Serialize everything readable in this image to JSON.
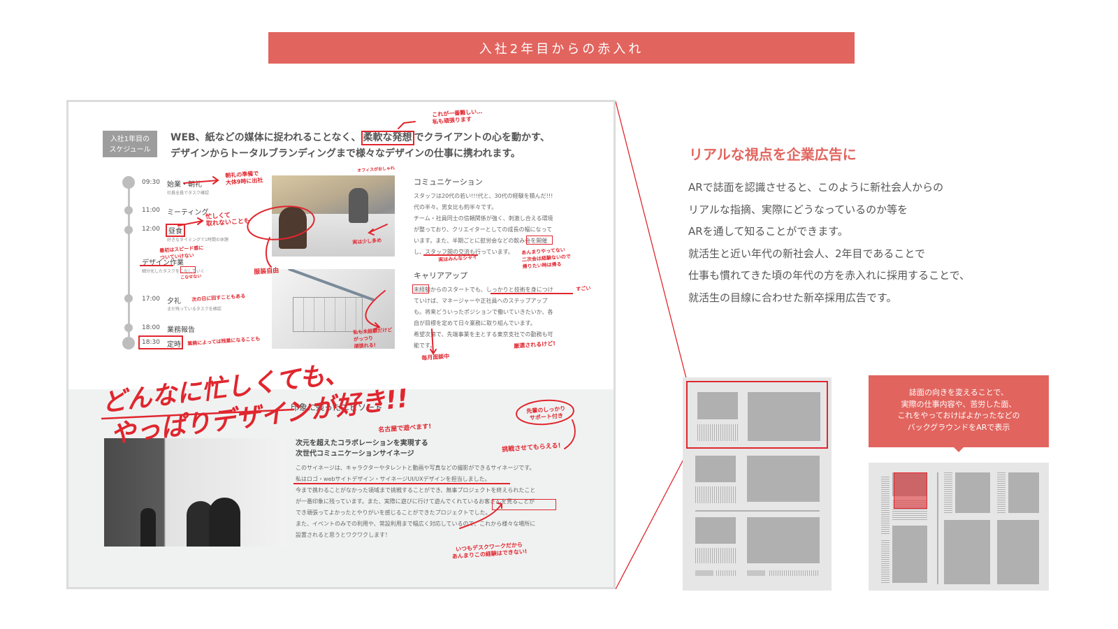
{
  "banner": {
    "title": "入社2年目からの赤入れ"
  },
  "magazine": {
    "tag": "入社1年目の\nスケジュール",
    "lead_1a": "WEB、紙などの媒体に捉われることなく、",
    "lead_1b": "柔軟な発想",
    "lead_1c": "でクライアントの心を動かす、",
    "lead_2": "デザインからトータルブランディングまで様々なデザインの仕事に携われます。",
    "schedule": [
      {
        "time": "09:30",
        "event": "始業・朝礼",
        "sub": "社員全員でタスク確認"
      },
      {
        "time": "11:00",
        "event": "ミーティング",
        "sub": ""
      },
      {
        "time": "12:00",
        "event": "昼食",
        "sub": "好きなタイミングで1時間の休憩"
      },
      {
        "time": "",
        "event": "デザイン作業",
        "sub": "細分化したタスクをこなしていく"
      },
      {
        "time": "17:00",
        "event": "夕礼",
        "sub": "まだ残っているタスクを確認"
      },
      {
        "time": "18:00",
        "event": "業務報告",
        "sub": ""
      },
      {
        "time": "18:30",
        "event": "定時",
        "sub": ""
      }
    ],
    "communication": {
      "title": "コミュニケーション",
      "lines": [
        "スタッフは20代の若い!!!代と、30代の経験を積んだ!!!",
        "代の半々。男女比も約半々です。",
        "チーム・社員同士の信頼関係が強く、刺激し合える環境",
        "が整っており、クリエイターとしての成長の幅になって",
        "います。また、半期ごとに慰労会などの飲み会を開催",
        "し、スタッフ間の交流も行っています。"
      ]
    },
    "career": {
      "title": "キャリアアップ",
      "lines": [
        "未経験からのスタートでも、しっかりと技術を身につけ",
        "ていけば、マネージャーや正社員へのステップアップ",
        "も。将来どういったポジションで働いていきたいか、各",
        "自が目標を定めて日々業務に取り組んでいます。",
        "希望次第で、先端事業を主とする東京支社での勤務も可",
        "能です。"
      ]
    },
    "episode": {
      "heading": "印象に残ったエピソード",
      "title_1": "次元を超えたコラボレーションを実現する",
      "title_2": "次世代コミュニケーションサイネージ",
      "lines": [
        "このサイネージは、キャラクターやタレントと動画や写真などの撮影ができるサイネージです。",
        "私はロゴ・webサイトデザイン・サイネージUI/UXデザインを担当しました。",
        "今まで携わることがなかった領域まで挑戦することができ、無事プロジェクトを終えられたこと",
        "が一番印象に残っています。また、実際に遊びに行けて遊んでくれているお客さんを見ることが",
        "でき頑張ってよかったとやりがいを感じることができたプロジェクトでした。",
        "また、イベントのみでの利用や、常設利用まで幅広く対応しているので、これから様々な場所に",
        "設置されると思うとワクワクします！"
      ]
    },
    "annotations": {
      "a1": "これが一番難しい…\n私も頑張ります",
      "a2": "朝礼の準備で\n大体9時に出社",
      "a3": "オフィスがおしゃれ",
      "a4": "忙しくて\n取れないことも",
      "a5": "最初はスピード感に\nついていけない",
      "a6": "こなせない",
      "a7": "次の日に回すこともある",
      "a8": "業務によっては残業になることも",
      "a9": "服装自由",
      "a10": "実は少し多め",
      "a11": "実はみんなシャイ",
      "a12": "あんまりやってない\n二次会は経験ないので\n帰りたい時は帰る",
      "a13": "私も未経験だけど\nがっつり\n頑張れる!",
      "a14": "すごい",
      "a15": "毎月面談中",
      "a16": "厳選されるけど!",
      "a17": "先輩のしっかり\nサポート付き",
      "a18": "名古屋で遊べます!",
      "a19": "挑戦させてもらえる!",
      "a20": "いつもデスクワークだから\nあんまりこの経験はできない!",
      "big_1": "どんなに忙しくても、",
      "big_2": "やっぱりデザインが好き!!"
    }
  },
  "right": {
    "title": "リアルな視点を企業広告に",
    "lines": [
      "ARで誌面を認識させると、このように新社会人からの",
      "リアルな指摘、実際にどうなっているのか等を",
      "ARを通して知ることができます。",
      "就活生と近い年代の新社会人、2年目であることで",
      "仕事も慣れてきた頃の年代の方を赤入れに採用することで、",
      "就活生の目線に合わせた新卒採用広告です。"
    ]
  },
  "callout": {
    "lines": [
      "誌面の向きを変えることで、",
      "実際の仕事内容や、苦労した面、",
      "これをやっておけばよかったなどの",
      "バックグラウンドをARで表示"
    ]
  },
  "colors": {
    "accent": "#e2645e",
    "ink_red": "#e0262e",
    "gray_box": "#9d9d9d"
  }
}
